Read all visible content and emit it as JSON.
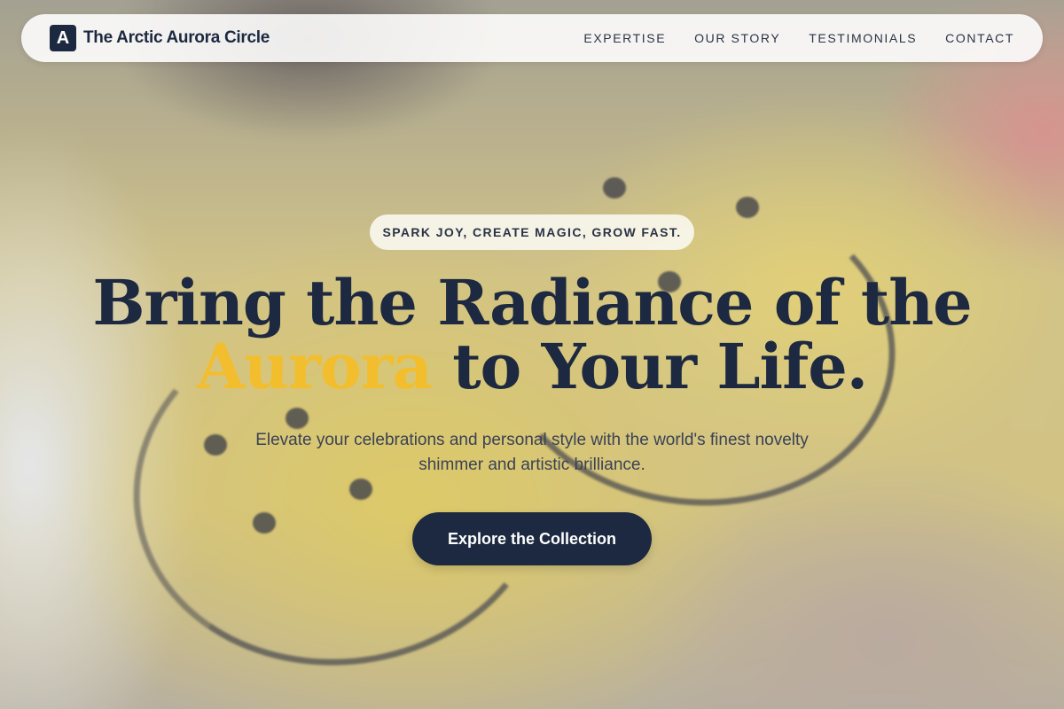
{
  "nav": {
    "brand_mark": "A",
    "brand_name": "The Arctic Aurora Circle",
    "links": [
      "EXPERTISE",
      "OUR STORY",
      "TESTIMONIALS",
      "CONTACT"
    ]
  },
  "hero": {
    "tagline": "SPARK JOY, CREATE MAGIC, GROW FAST.",
    "headline_line1": "Bring the Radiance of the",
    "headline_accent": "Aurora",
    "headline_rest": " to Your Life.",
    "subtitle": "Elevate your celebrations and personal style with the world's finest novelty shimmer and artistic brilliance.",
    "cta_label": "Explore the Collection"
  },
  "colors": {
    "primary": "#1d2940",
    "accent": "#f2be2e"
  }
}
